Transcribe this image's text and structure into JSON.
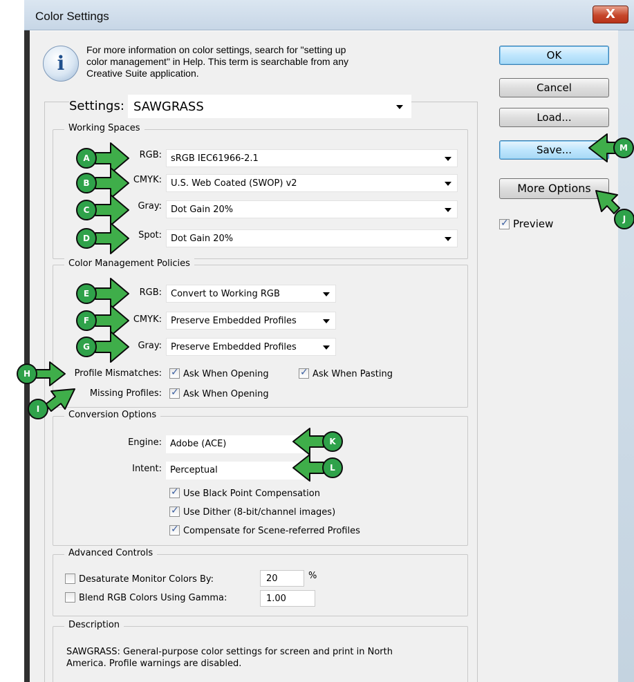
{
  "window": {
    "title": "Color Settings",
    "close_glyph": "X"
  },
  "info": {
    "icon": "info-icon",
    "line1": "For more information on color settings, search for \"setting up",
    "line2": "color management\" in Help. This term is searchable from any",
    "line3": "Creative Suite application."
  },
  "settings": {
    "label": "Settings:",
    "value": "SAWGRASS"
  },
  "buttons": {
    "ok": "OK",
    "cancel": "Cancel",
    "load": "Load...",
    "save": "Save...",
    "more_options": "More Options",
    "preview_label": "Preview",
    "preview_checked": true
  },
  "working_spaces": {
    "title": "Working Spaces",
    "rows": [
      {
        "label": "RGB:",
        "value": "sRGB IEC61966-2.1"
      },
      {
        "label": "CMYK:",
        "value": "U.S. Web Coated (SWOP) v2"
      },
      {
        "label": "Gray:",
        "value": "Dot Gain 20%"
      },
      {
        "label": "Spot:",
        "value": "Dot Gain 20%"
      }
    ]
  },
  "policies": {
    "title": "Color Management Policies",
    "rows": [
      {
        "label": "RGB:",
        "value": "Convert to Working RGB"
      },
      {
        "label": "CMYK:",
        "value": "Preserve Embedded Profiles"
      },
      {
        "label": "Gray:",
        "value": "Preserve Embedded Profiles"
      }
    ],
    "mismatch_label": "Profile Mismatches:",
    "mismatch_open": "Ask When Opening",
    "mismatch_paste": "Ask When Pasting",
    "missing_label": "Missing Profiles:",
    "missing_open": "Ask When Opening"
  },
  "conversion": {
    "title": "Conversion Options",
    "engine_label": "Engine:",
    "engine_value": "Adobe (ACE)",
    "intent_label": "Intent:",
    "intent_value": "Perceptual",
    "bpc": "Use Black Point Compensation",
    "dither": "Use Dither (8-bit/channel images)",
    "scene": "Compensate for Scene-referred Profiles"
  },
  "advanced": {
    "title": "Advanced Controls",
    "desaturate_label": "Desaturate Monitor Colors By:",
    "desaturate_value": "20",
    "desaturate_unit": "%",
    "blend_label": "Blend RGB Colors Using Gamma:",
    "blend_value": "1.00"
  },
  "description": {
    "title": "Description",
    "line1": "SAWGRASS:  General-purpose color settings for screen and print in North",
    "line2": "America. Profile warnings are disabled."
  },
  "callouts": [
    "A",
    "B",
    "C",
    "D",
    "E",
    "F",
    "G",
    "H",
    "I",
    "J",
    "K",
    "L",
    "M"
  ],
  "colors": {
    "callout_green": "#2fa24a",
    "default_button": "#bee6fd",
    "close_red": "#c6472b"
  }
}
